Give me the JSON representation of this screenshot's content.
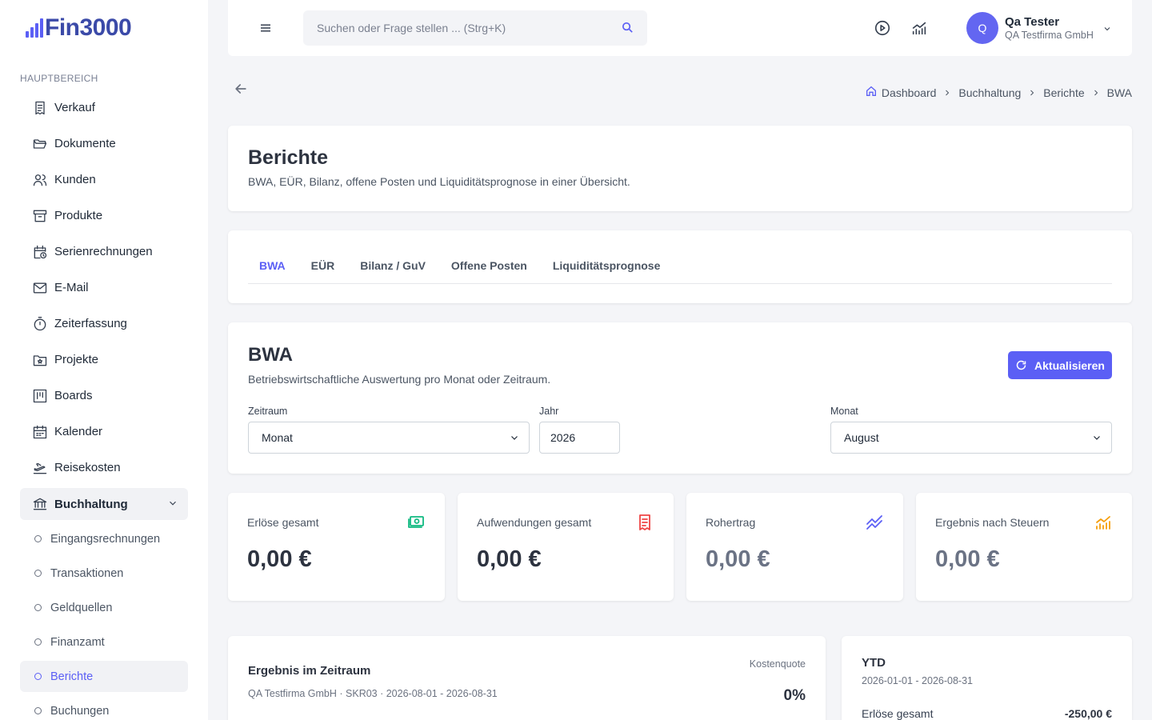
{
  "app": {
    "logo_text": "Fin3000"
  },
  "sidebar": {
    "section_label": "HAUPTBEREICH",
    "items": [
      {
        "label": "Verkauf",
        "icon": "receipt-icon"
      },
      {
        "label": "Dokumente",
        "icon": "folder-open-icon"
      },
      {
        "label": "Kunden",
        "icon": "users-icon"
      },
      {
        "label": "Produkte",
        "icon": "archive-box-icon"
      },
      {
        "label": "Serienrechnungen",
        "icon": "calendar-clock-icon"
      },
      {
        "label": "E-Mail",
        "icon": "mail-icon"
      },
      {
        "label": "Zeiterfassung",
        "icon": "stopwatch-icon"
      },
      {
        "label": "Projekte",
        "icon": "folder-star-icon"
      },
      {
        "label": "Boards",
        "icon": "kanban-board-icon"
      },
      {
        "label": "Kalender",
        "icon": "calendar-icon"
      },
      {
        "label": "Reisekosten",
        "icon": "plane-departure-icon"
      }
    ],
    "group": {
      "label": "Buchhaltung",
      "icon": "bank-icon"
    },
    "sub_items": [
      {
        "label": "Eingangsrechnungen"
      },
      {
        "label": "Transaktionen"
      },
      {
        "label": "Geldquellen"
      },
      {
        "label": "Finanzamt"
      },
      {
        "label": "Berichte",
        "active": true
      },
      {
        "label": "Buchungen"
      }
    ]
  },
  "topbar": {
    "search_placeholder": "Suchen oder Frage stellen ... (Strg+K)",
    "user": {
      "initial": "Q",
      "name": "Qa Tester",
      "company": "QA Testfirma GmbH"
    }
  },
  "breadcrumb": [
    "Dashboard",
    "Buchhaltung",
    "Berichte",
    "BWA"
  ],
  "header": {
    "title": "Berichte",
    "description": "BWA, EÜR, Bilanz, offene Posten und Liquiditätsprognose in einer Übersicht."
  },
  "tabs": [
    {
      "label": "BWA",
      "active": true
    },
    {
      "label": "EÜR"
    },
    {
      "label": "Bilanz / GuV"
    },
    {
      "label": "Offene Posten"
    },
    {
      "label": "Liquiditätsprognose"
    }
  ],
  "bwa": {
    "title": "BWA",
    "description": "Betriebswirtschaftliche Auswertung pro Monat oder Zeitraum.",
    "refresh_label": "Aktualisieren",
    "fields": {
      "zeitraum": {
        "label": "Zeitraum",
        "value": "Monat"
      },
      "jahr": {
        "label": "Jahr",
        "value": "2026"
      },
      "monat": {
        "label": "Monat",
        "value": "August"
      }
    }
  },
  "kpis": [
    {
      "label": "Erlöse gesamt",
      "value": "0,00 €",
      "icon": "banknote-icon",
      "color": "#10b981"
    },
    {
      "label": "Aufwendungen gesamt",
      "value": "0,00 €",
      "icon": "receipt-icon",
      "color": "#ef4444"
    },
    {
      "label": "Rohertrag",
      "value": "0,00 €",
      "icon": "trend-up-icon",
      "color": "#5b5ff5"
    },
    {
      "label": "Ergebnis nach Steuern",
      "value": "0,00 €",
      "icon": "chart-bars-icon",
      "color": "#f59e0b"
    }
  ],
  "result": {
    "title": "Ergebnis im Zeitraum",
    "meta": "QA Testfirma GmbH · SKR03 · 2026-08-01 - 2026-08-31",
    "quota_label": "Kostenquote",
    "quota_value": "0%"
  },
  "ytd": {
    "title": "YTD",
    "range": "2026-01-01 - 2026-08-31",
    "row_label": "Erlöse gesamt",
    "row_value": "-250,00 €"
  },
  "colors": {
    "accent": "#5b5ff5",
    "background": "#f4f5f8"
  }
}
